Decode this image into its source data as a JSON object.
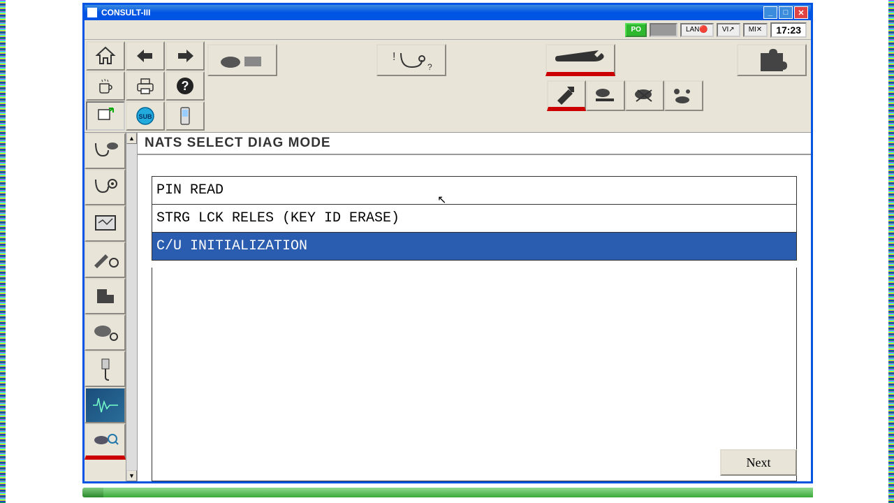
{
  "window": {
    "title": "CONSULT-III"
  },
  "status": {
    "po": "PO",
    "lan": "LAN",
    "vi": "VI",
    "mi": "MI",
    "clock": "17:23"
  },
  "page": {
    "title": "NATS SELECT DIAG MODE"
  },
  "list": {
    "items": [
      {
        "label": "PIN READ",
        "selected": false
      },
      {
        "label": "STRG LCK RELES (KEY ID ERASE)",
        "selected": false
      },
      {
        "label": "C/U INITIALIZATION",
        "selected": true
      }
    ]
  },
  "buttons": {
    "next": "Next"
  }
}
